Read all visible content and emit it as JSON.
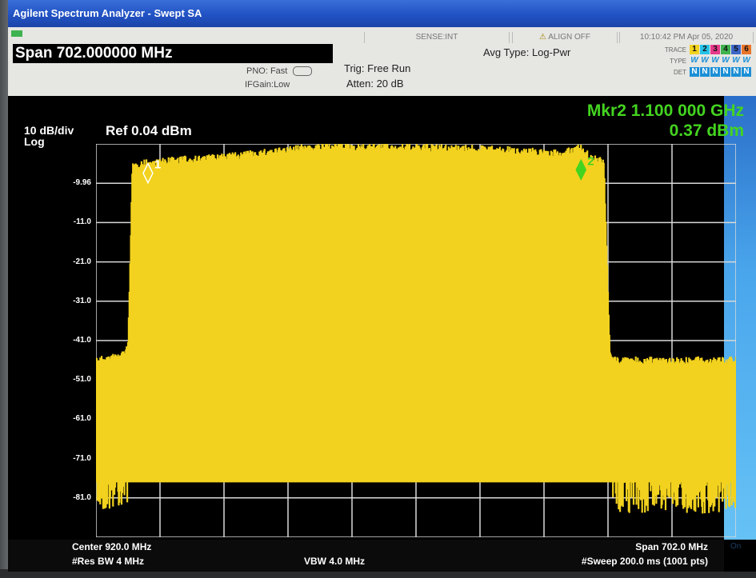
{
  "window": {
    "title": "Agilent Spectrum Analyzer - Swept SA"
  },
  "status_bar": {
    "sense": "SENSE:INT",
    "alert": "ALIGN OFF",
    "time": "10:10:42 PM Apr 05, 2020"
  },
  "header": {
    "span": "Span 702.000000 MHz",
    "pno": "PNO: Fast",
    "ifgain": "IFGain:Low",
    "trig": "Trig: Free Run",
    "atten": "Atten: 20 dB",
    "avg_type": "Avg Type: Log-Pwr"
  },
  "trace_table": {
    "trace_label": "TRACE",
    "type_label": "TYPE",
    "det_label": "DET",
    "traces": [
      "1",
      "2",
      "3",
      "4",
      "5",
      "6"
    ],
    "trace_colors": [
      "#f2d21e",
      "#27c2e8",
      "#e63a8a",
      "#3fb34f",
      "#3c66c8",
      "#e8742a"
    ],
    "types": [
      "W",
      "W",
      "W",
      "W",
      "W",
      "W"
    ],
    "dets": [
      "N",
      "N",
      "N",
      "N",
      "N",
      "N"
    ]
  },
  "display": {
    "scale": "10 dB/div",
    "scale_type": "Log",
    "ref_level": "Ref 0.04 dBm",
    "marker_freq": "Mkr2 1.100 000 GHz",
    "marker_amp": "0.37 dBm",
    "y_ticks": [
      "-9.96",
      "-11.0",
      "-21.0",
      "-31.0",
      "-41.0",
      "-51.0",
      "-61.0",
      "-71.0",
      "-81.0"
    ],
    "marker_labels": [
      "1",
      "2"
    ],
    "trace_color": "#f2d21e",
    "grid_color": "#d9d9d9"
  },
  "chart_data": {
    "type": "line",
    "x_unit": "MHz",
    "y_unit": "dBm",
    "xlim": [
      568.0,
      1270.0
    ],
    "ylim": [
      -90.0,
      0.04
    ],
    "series": [
      {
        "x": [
          568,
          593,
          603,
          608,
          615,
          640,
          660,
          700,
          740,
          780,
          800,
          840,
          880,
          920,
          960,
          1000,
          1040,
          1080,
          1100,
          1110,
          1125,
          1132,
          1140,
          1160,
          1200,
          1240,
          1270
        ],
        "y": [
          -54,
          -53,
          -51,
          -5,
          -4,
          -3.5,
          -3,
          -2.5,
          -1.5,
          -0.5,
          0.2,
          0.4,
          0.3,
          0.1,
          0,
          -0.3,
          -0.8,
          -1.5,
          0.37,
          -2.5,
          -3.5,
          -53,
          -54,
          -54,
          -54,
          -54,
          -54
        ]
      }
    ],
    "markers": [
      {
        "label": "1",
        "x": 625,
        "y": -0.5
      },
      {
        "label": "2",
        "x": 1100,
        "y": 0.37
      }
    ]
  },
  "footer": {
    "center": "Center 920.0 MHz",
    "res_bw": "#Res BW 4 MHz",
    "vbw": "VBW 4.0 MHz",
    "span": "Span 702.0 MHz",
    "sweep": "#Sweep  200.0 ms (1001 pts)"
  },
  "softkeys": {
    "label": "On"
  }
}
